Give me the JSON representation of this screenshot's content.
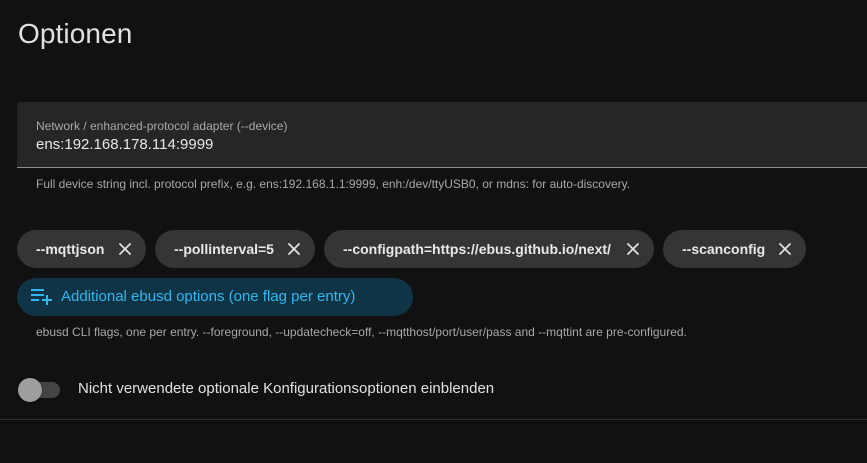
{
  "page": {
    "title": "Optionen"
  },
  "device_field": {
    "label": "Network / enhanced-protocol adapter (--device)",
    "value": "ens:192.168.178.114:9999",
    "helper": "Full device string incl. protocol prefix, e.g. ens:192.168.1.1:9999, enh:/dev/ttyUSB0, or mdns: for auto-discovery."
  },
  "options": {
    "chips": [
      {
        "label": "--mqttjson",
        "remove_icon": "close-icon"
      },
      {
        "label": "--pollinterval=5",
        "remove_icon": "close-icon"
      },
      {
        "label": "--configpath=https://ebus.github.io/next/",
        "remove_icon": "close-icon"
      },
      {
        "label": "--scanconfig",
        "remove_icon": "close-icon"
      }
    ],
    "add_button": {
      "label": "Additional ebusd options (one flag per entry)",
      "icon": "playlist-add-icon"
    },
    "helper": "ebusd CLI flags, one per entry. --foreground, --updatecheck=off, --mqtthost/port/user/pass and --mqttint are pre-configured."
  },
  "toggle": {
    "label": "Nicht verwendete optionale Konfigurationsoptionen einblenden",
    "checked": false
  },
  "colors": {
    "background": "#111111",
    "field_bg": "#262626",
    "chip_bg": "#353535",
    "accent": "#2fb7f1",
    "accent_bg": "#0f3445"
  }
}
